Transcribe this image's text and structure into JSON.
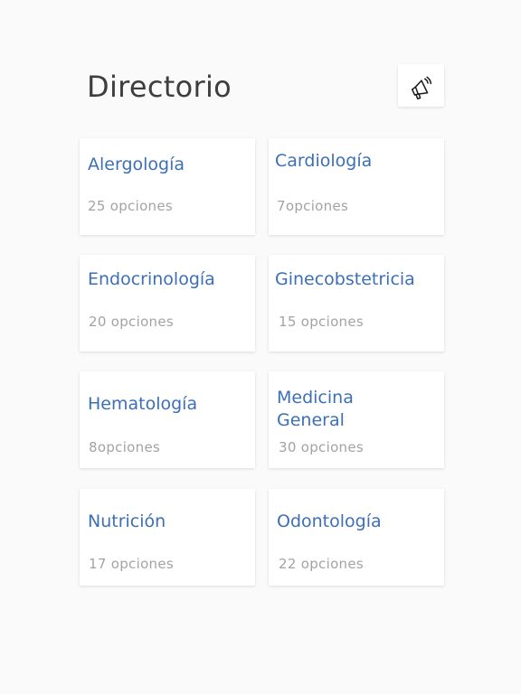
{
  "header": {
    "title": "Directorio",
    "announce_icon": "megaphone-icon"
  },
  "specialties": [
    {
      "name": "Alergología",
      "count": "25 opciones"
    },
    {
      "name": "Cardiología",
      "count": "7opciones"
    },
    {
      "name": "Endocrinología",
      "count": "20 opciones"
    },
    {
      "name": "Ginecobstetricia",
      "count": "15 opciones"
    },
    {
      "name": "Hematología",
      "count": "8opciones"
    },
    {
      "name": "Medicina General",
      "count": "30 opciones"
    },
    {
      "name": "Nutrición",
      "count": "17 opciones"
    },
    {
      "name": "Odontología",
      "count": "22 opciones"
    }
  ],
  "colors": {
    "accent": "#3d6fb7",
    "title": "#3e3e3e",
    "muted": "#a3a3a3",
    "background": "#fafafa"
  }
}
